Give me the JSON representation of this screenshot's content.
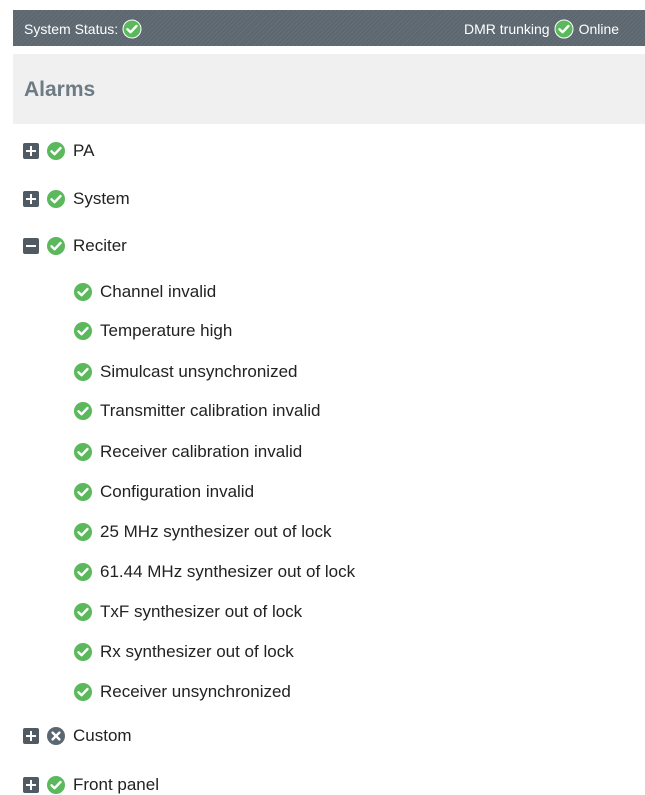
{
  "status_bar": {
    "system_status_label": "System Status:",
    "mode_label": "DMR trunking",
    "online_label": "Online"
  },
  "header": {
    "title": "Alarms"
  },
  "colors": {
    "ok": "#5cb85c",
    "fault": "#5a6670",
    "bar": "#5c6770"
  },
  "alarms": {
    "pa": {
      "label": "PA",
      "state": "ok",
      "expanded": false
    },
    "system": {
      "label": "System",
      "state": "ok",
      "expanded": false
    },
    "reciter": {
      "label": "Reciter",
      "state": "ok",
      "expanded": true,
      "items": [
        {
          "label": "Channel invalid",
          "state": "ok"
        },
        {
          "label": "Temperature high",
          "state": "ok"
        },
        {
          "label": "Simulcast unsynchronized",
          "state": "ok"
        },
        {
          "label": "Transmitter calibration invalid",
          "state": "ok"
        },
        {
          "label": "Receiver calibration invalid",
          "state": "ok"
        },
        {
          "label": "Configuration invalid",
          "state": "ok"
        },
        {
          "label": "25 MHz synthesizer out of lock",
          "state": "ok"
        },
        {
          "label": "61.44 MHz synthesizer out of lock",
          "state": "ok"
        },
        {
          "label": "TxF synthesizer out of lock",
          "state": "ok"
        },
        {
          "label": "Rx synthesizer out of lock",
          "state": "ok"
        },
        {
          "label": "Receiver unsynchronized",
          "state": "ok"
        }
      ]
    },
    "custom": {
      "label": "Custom",
      "state": "fault",
      "expanded": false
    },
    "front_panel": {
      "label": "Front panel",
      "state": "ok",
      "expanded": false
    }
  }
}
